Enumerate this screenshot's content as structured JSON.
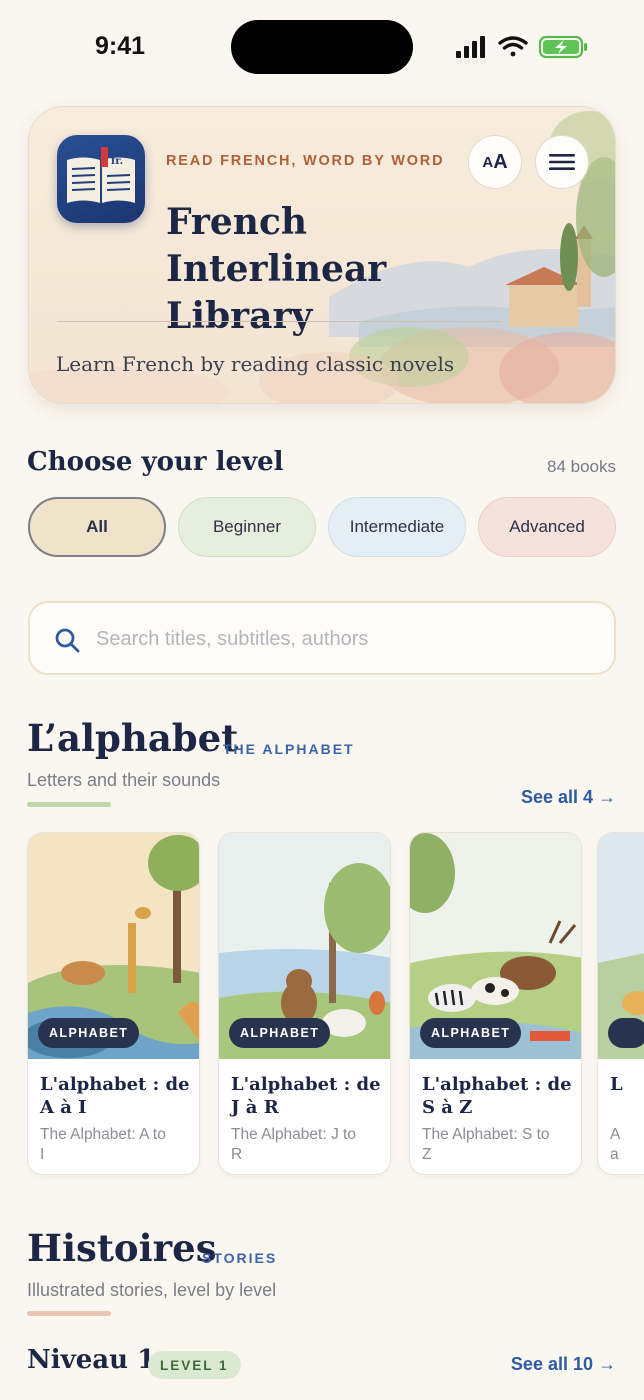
{
  "status": {
    "time": "9:41"
  },
  "hero": {
    "app_icon_text": "fr.",
    "eyebrow": "READ FRENCH, WORD BY WORD",
    "title": "French Interlinear Library",
    "subtitle": "Learn French by reading classic novels",
    "font_button_small": "A",
    "font_button_large": "A"
  },
  "levels": {
    "title": "Choose your level",
    "count": "84 books",
    "chips": [
      {
        "label": "All",
        "selected": true
      },
      {
        "label": "Beginner",
        "selected": false
      },
      {
        "label": "Intermediate",
        "selected": false
      },
      {
        "label": "Advanced",
        "selected": false
      }
    ]
  },
  "search": {
    "placeholder": "Search titles, subtitles, authors"
  },
  "sections": [
    {
      "title": "L’alphabet",
      "tag": "THE ALPHABET",
      "subtitle": "Letters and their sounds",
      "see_all": "See all 4 →",
      "accent": "#bcd8a8",
      "cards": [
        {
          "badge": "ALPHABET",
          "title": "L'alphabet : de A à I",
          "subtitle": "The Alphabet: A to I"
        },
        {
          "badge": "ALPHABET",
          "title": "L'alphabet : de J à R",
          "subtitle": "The Alphabet: J to R"
        },
        {
          "badge": "ALPHABET",
          "title": "L'alphabet : de S à Z",
          "subtitle": "The Alphabet: S to Z"
        },
        {
          "badge": "ALPHABET",
          "title": "L",
          "subtitle": "A a"
        }
      ]
    },
    {
      "title": "Histoires",
      "tag": "STORIES",
      "subtitle": "Illustrated stories, level by level",
      "accent": "#ecc3b4",
      "rows": [
        {
          "title": "Niveau 1",
          "badge": "LEVEL 1",
          "see_all": "See all 10 →"
        }
      ]
    }
  ]
}
